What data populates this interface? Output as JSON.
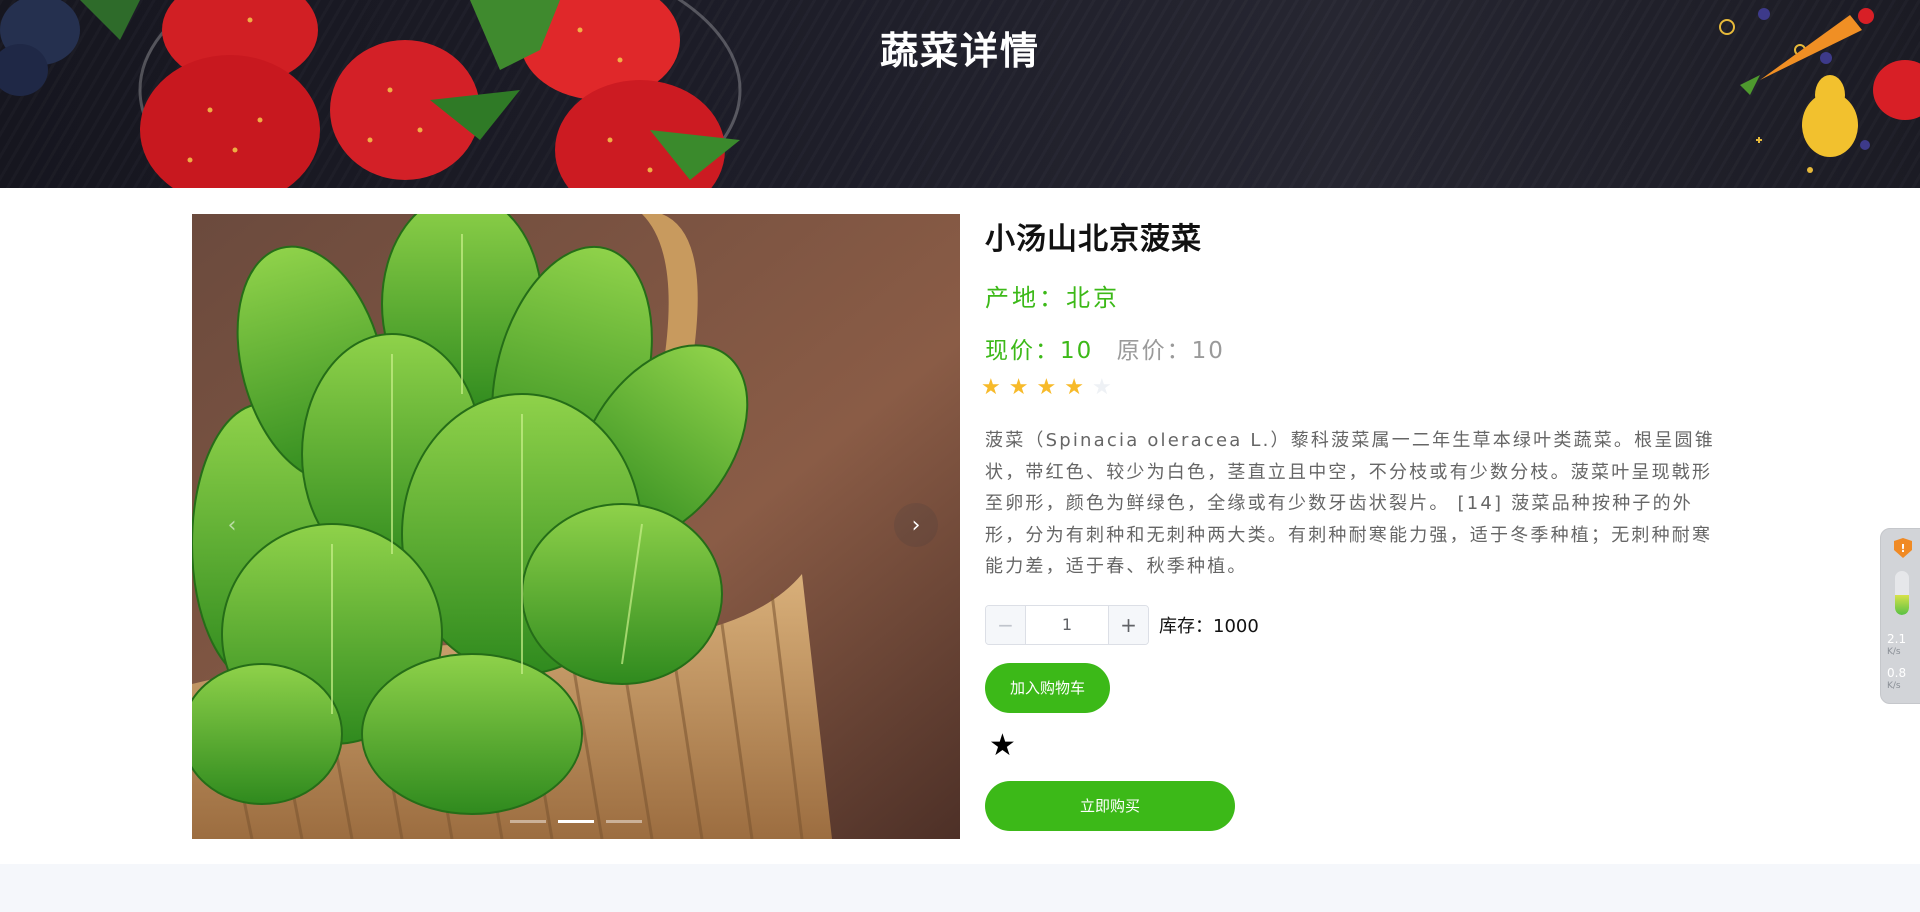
{
  "header": {
    "title": "蔬菜详情"
  },
  "product": {
    "name": "小汤山北京菠菜",
    "origin_label": "产地：",
    "origin": "北京",
    "price_now_label": "现价：",
    "price_now": "10",
    "price_original_label": "原价：",
    "price_original": "10",
    "rating": 4,
    "rating_max": 5,
    "description": "菠菜（Spinacia oleracea L.）藜科菠菜属一二年生草本绿叶类蔬菜。根呈圆锥状，带红色、较少为白色，茎直立且中空，不分枝或有少数分枝。菠菜叶呈现戟形至卵形，颜色为鲜绿色，全缘或有少数牙齿状裂片。 [14] 菠菜品种按种子的外形，分为有刺种和无刺种两大类。有刺种耐寒能力强，适于冬季种植；无刺种耐寒能力差，适于春、秋季种植。"
  },
  "quantity": {
    "value": "1",
    "minus_icon": "minus-icon",
    "plus_icon": "plus-icon"
  },
  "stock": {
    "label": "库存：",
    "value": "1000"
  },
  "actions": {
    "add_to_cart": "加入购物车",
    "buy_now": "立即购买",
    "favorite_icon": "star-icon"
  },
  "carousel": {
    "slides": 3,
    "active": 2,
    "prev_icon": "chevron-left-icon",
    "next_icon": "chevron-right-icon"
  },
  "side_widget": {
    "badge": "!",
    "upload_speed": "2.1",
    "upload_unit": "K/s",
    "download_speed": "0.8",
    "download_unit": "K/s",
    "battery_level": 0.45
  },
  "colors": {
    "accent": "#3cb918",
    "star": "#f7ba2a",
    "banner": "#1d1d28"
  }
}
